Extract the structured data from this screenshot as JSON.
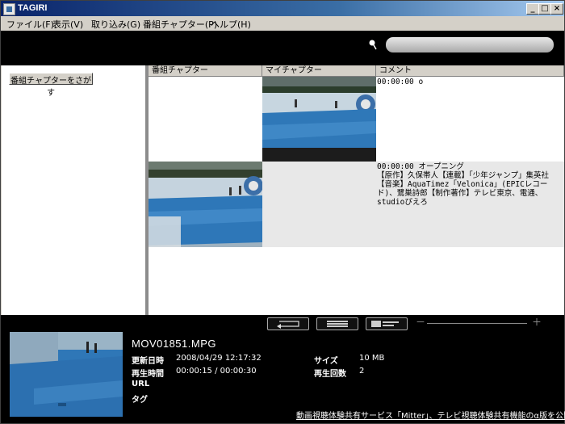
{
  "window": {
    "title": "TAGIRI"
  },
  "menu": [
    "ファイル(F)",
    "表示(V)",
    "取り込み(G)",
    "番組チャプター(P)",
    "ヘルプ(H)"
  ],
  "search": {
    "placeholder": ""
  },
  "sidebar": {
    "find_button": "番組チャプターをさがす"
  },
  "grid": {
    "headers": [
      "番組チャプター",
      "マイチャプター",
      "コメント"
    ],
    "rows": [
      {
        "comment": "00:00:00 o"
      },
      {
        "comment": "00:00:00 オープニング\n【原作】久保帯人【連載】「少年ジャンプ」集英社【音楽】AquaTimez「Velonica」(EPICレコード)、鷺巣詩郎【制作著作】テレビ東京、電通、studioぴえろ"
      }
    ]
  },
  "details": {
    "filename": "MOV01851.MPG",
    "labels": {
      "updated": "更新日時",
      "playtime": "再生時間",
      "url": "URL",
      "tags": "タグ",
      "size": "サイズ",
      "play_count": "再生回数"
    },
    "values": {
      "updated": "2008/04/29 12:17:32",
      "playtime": "00:00:15 / 00:00:30",
      "url": "",
      "tags": "",
      "size": "10 MB",
      "play_count": "2"
    }
  },
  "zoom": {
    "minus": "－",
    "plus": "＋"
  },
  "footer": {
    "link": "動画視聴体験共有サービス「Mitter」、テレビ視聴体験共有機能のα版を公開"
  }
}
